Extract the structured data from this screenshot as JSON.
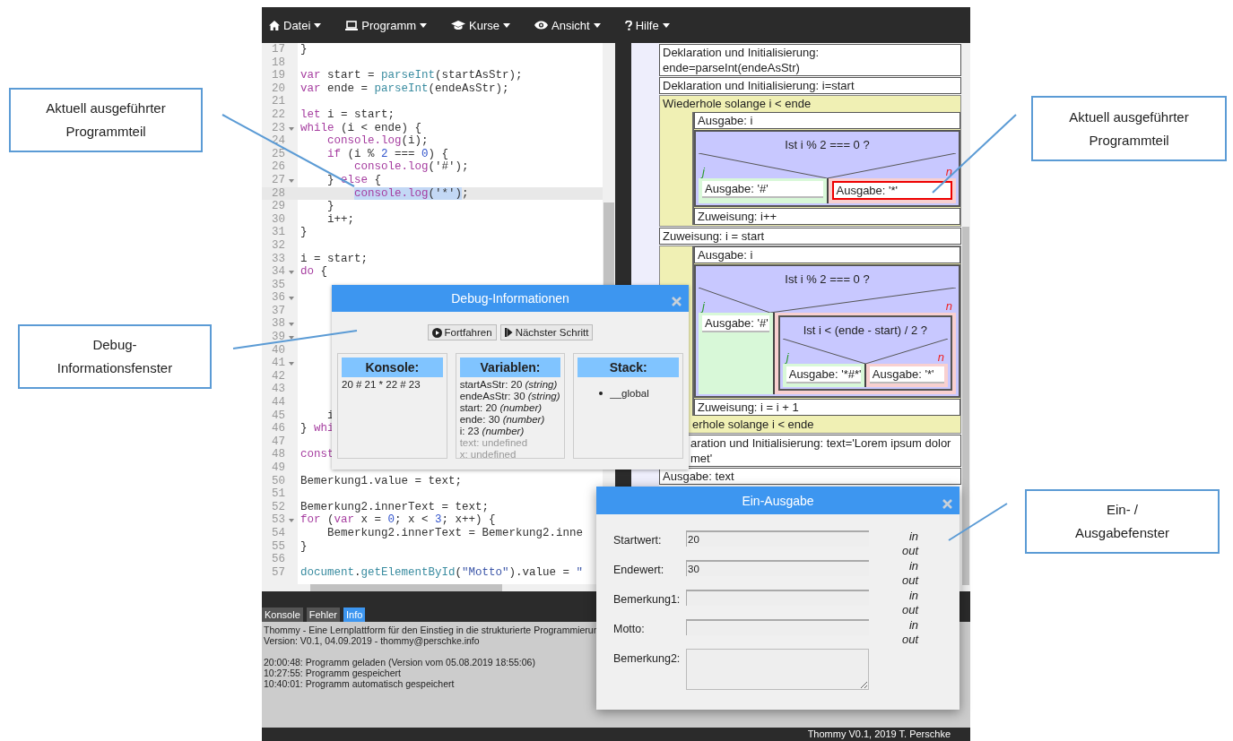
{
  "menu": [
    {
      "label": "Datei"
    },
    {
      "label": "Programm"
    },
    {
      "label": "Kurse"
    },
    {
      "label": "Ansicht"
    },
    {
      "label": "Hilfe"
    }
  ],
  "editor": {
    "lines": [
      {
        "n": "17",
        "fold": false,
        "current": false,
        "code": [
          "}"
        ]
      },
      {
        "n": "18",
        "fold": false,
        "current": false
      },
      {
        "n": "19",
        "fold": false,
        "current": false,
        "code": [
          {
            "kind": "kw",
            "t": "var"
          },
          " start = ",
          {
            "kind": "fn",
            "t": "parseInt"
          },
          "(startAsStr);"
        ]
      },
      {
        "n": "20",
        "fold": false,
        "current": false,
        "code": [
          {
            "kind": "kw",
            "t": "var"
          },
          " ende = ",
          {
            "kind": "fn",
            "t": "parseInt"
          },
          "(endeAsStr);"
        ]
      },
      {
        "n": "21",
        "fold": false,
        "current": false
      },
      {
        "n": "22",
        "fold": false,
        "current": false,
        "code": [
          {
            "kind": "kw",
            "t": "let"
          },
          " i = start;"
        ]
      },
      {
        "n": "23",
        "fold": true,
        "current": false,
        "code": [
          {
            "kind": "kw",
            "t": "while"
          },
          " (i < ende) {"
        ]
      },
      {
        "n": "24",
        "fold": false,
        "current": false,
        "code": [
          {
            "kind": "kw",
            "t": "    console.log"
          },
          "(i);"
        ]
      },
      {
        "n": "25",
        "fold": false,
        "current": false,
        "code": [
          {
            "kind": "kw",
            "t": "    if"
          },
          " (i % ",
          {
            "kind": "num",
            "t": "2"
          },
          " === ",
          {
            "kind": "num",
            "t": "0"
          },
          ") {"
        ]
      },
      {
        "n": "26",
        "fold": false,
        "current": false,
        "code": [
          {
            "kind": "kw",
            "t": "        console.log"
          },
          "('#');"
        ]
      },
      {
        "n": "27",
        "fold": true,
        "current": false,
        "code": [
          "    } ",
          {
            "kind": "kw",
            "t": "else"
          },
          " {"
        ]
      },
      {
        "n": "28",
        "fold": false,
        "current": true,
        "code": [
          {
            "kind": "kwsel",
            "t": "        console.log"
          },
          {
            "kind": "sel",
            "t": "('*')"
          },
          ";"
        ]
      },
      {
        "n": "29",
        "fold": false,
        "current": false,
        "code": [
          "    }"
        ]
      },
      {
        "n": "30",
        "fold": false,
        "current": false,
        "code": [
          "    i++;"
        ]
      },
      {
        "n": "31",
        "fold": false,
        "current": false,
        "code": [
          "}"
        ]
      },
      {
        "n": "32",
        "fold": false,
        "current": false
      },
      {
        "n": "33",
        "fold": false,
        "current": false,
        "code": [
          "i = start;"
        ]
      },
      {
        "n": "34",
        "fold": true,
        "current": false,
        "code": [
          {
            "kind": "kw",
            "t": "do"
          },
          " {"
        ]
      },
      {
        "n": "35",
        "fold": false,
        "current": false
      },
      {
        "n": "36",
        "fold": true,
        "current": false
      },
      {
        "n": "37",
        "fold": false,
        "current": false
      },
      {
        "n": "38",
        "fold": true,
        "current": false
      },
      {
        "n": "39",
        "fold": true,
        "current": false
      },
      {
        "n": "40",
        "fold": false,
        "current": false
      },
      {
        "n": "41",
        "fold": true,
        "current": false
      },
      {
        "n": "42",
        "fold": false,
        "current": false
      },
      {
        "n": "43",
        "fold": false,
        "current": false
      },
      {
        "n": "44",
        "fold": false,
        "current": false
      },
      {
        "n": "45",
        "fold": false,
        "current": false,
        "code": [
          "    i"
        ]
      },
      {
        "n": "46",
        "fold": false,
        "current": false,
        "code": [
          "} ",
          {
            "kind": "kw",
            "t": "whi"
          }
        ]
      },
      {
        "n": "47",
        "fold": false,
        "current": false
      },
      {
        "n": "48",
        "fold": false,
        "current": false,
        "code": [
          {
            "kind": "kw",
            "t": "const"
          }
        ]
      },
      {
        "n": "49",
        "fold": false,
        "current": false
      },
      {
        "n": "50",
        "fold": false,
        "current": false,
        "code": [
          "Bemerkung1.value = text;"
        ]
      },
      {
        "n": "51",
        "fold": false,
        "current": false
      },
      {
        "n": "52",
        "fold": false,
        "current": false,
        "code": [
          "Bemerkung2.innerText = text;"
        ]
      },
      {
        "n": "53",
        "fold": true,
        "current": false,
        "code": [
          {
            "kind": "kw",
            "t": "for"
          },
          " (",
          {
            "kind": "kw",
            "t": "var"
          },
          " x = ",
          {
            "kind": "num",
            "t": "0"
          },
          "; x < ",
          {
            "kind": "num",
            "t": "3"
          },
          "; x++) {"
        ]
      },
      {
        "n": "54",
        "fold": false,
        "current": false,
        "code": [
          "    Bemerkung2.innerText = Bemerkung2.inne"
        ]
      },
      {
        "n": "55",
        "fold": false,
        "current": false,
        "code": [
          "}"
        ]
      },
      {
        "n": "56",
        "fold": false,
        "current": false
      },
      {
        "n": "57",
        "fold": false,
        "current": false,
        "code": [
          {
            "kind": "fn",
            "t": "document"
          },
          ".",
          {
            "kind": "fn",
            "t": "getElementById"
          },
          "(",
          {
            "kind": "str",
            "t": "\"Motto\""
          },
          ").value = ",
          {
            "kind": "str",
            "t": "\""
          }
        ]
      }
    ]
  },
  "structogram": [
    {
      "kind": "statement",
      "text": "Deklaration und Initialisierung:\nende=parseInt(endeAsStr)",
      "active": false
    },
    {
      "kind": "statement",
      "text": "Deklaration und Initialisierung: i=start",
      "active": false
    },
    {
      "kind": "loop",
      "header": "Wiederhole solange i < ende",
      "body": [
        {
          "kind": "statement",
          "text": "Ausgabe: i",
          "active": false
        },
        {
          "kind": "if",
          "condition": "Ist i % 2 === 0 ?",
          "yes_label": "j",
          "no_label": "n",
          "yes": [
            {
              "kind": "statement",
              "text": "Ausgabe: '#'",
              "active": false
            }
          ],
          "no": [
            {
              "kind": "statement",
              "text": "Ausgabe: '*'",
              "active": true
            }
          ]
        },
        {
          "kind": "statement",
          "text": "Zuweisung: i++",
          "active": false
        }
      ]
    },
    {
      "kind": "statement",
      "text": "Zuweisung: i = start",
      "active": false
    },
    {
      "kind": "loop",
      "footer": "erhole solange i < ende",
      "body": [
        {
          "kind": "statement",
          "text": "Ausgabe: i",
          "active": false
        },
        {
          "kind": "if",
          "condition": "Ist i % 2 === 0 ?",
          "yes_label": "j",
          "no_label": "n",
          "yes": [
            {
              "kind": "statement",
              "text": "Ausgabe: '#'",
              "active": false
            }
          ],
          "no": [
            {
              "kind": "if",
              "condition": "Ist i < (ende - start) / 2 ?",
              "yes_label": "j",
              "no_label": "n",
              "yes": [
                {
                  "kind": "statement",
                  "text": "Ausgabe: '*#*'",
                  "active": false
                }
              ],
              "no": [
                {
                  "kind": "statement",
                  "text": "Ausgabe: '*'",
                  "active": false
                }
              ]
            }
          ]
        },
        {
          "kind": "statement",
          "text": "Zuweisung: i = i + 1",
          "active": false
        }
      ]
    },
    {
      "kind": "statement",
      "text": "aration und Initialisierung: text='Lorem ipsum dolor\nmet'",
      "active": false,
      "covered_left": true
    },
    {
      "kind": "statement",
      "text": "Ausgabe: text",
      "active": false
    }
  ],
  "bottom_panel": {
    "tabs": [
      {
        "label": "Konsole",
        "selected": false
      },
      {
        "label": "Fehler",
        "selected": false
      },
      {
        "label": "Info",
        "selected": true
      }
    ],
    "info": [
      [
        "Thommy - Eine Lernplattform für den Einstieg in die strukturierte Programmierun",
        "Version: V0.1, 04.09.2019 - thommy@perschke.info"
      ],
      [
        "20:00:48: Programm geladen (Version vom 05.08.2019 18:55:06)",
        "10:27:55: Programm gespeichert",
        "10:40:01: Programm automatisch gespeichert"
      ]
    ]
  },
  "status_bar": "Thommy V0.1, 2019 T. Perschke",
  "debug_window": {
    "title": "Debug-Informationen",
    "buttons": [
      {
        "label": "Fortfahren"
      },
      {
        "label": "Nächster Schritt"
      }
    ],
    "console": {
      "heading": "Konsole:",
      "output": "20 # 21 * 22 # 23"
    },
    "variables": {
      "heading": "Variablen:",
      "items": [
        {
          "text": "startAsStr: 20 *(string)*",
          "defined": true
        },
        {
          "text": "endeAsStr: 30 *(string)*",
          "defined": true
        },
        {
          "text": "start: 20 *(number)*",
          "defined": true
        },
        {
          "text": "ende: 30 *(number)*",
          "defined": true
        },
        {
          "text": "i: 23 *(number)*",
          "defined": true
        },
        {
          "text": "text: undefined",
          "defined": false
        },
        {
          "text": "x: undefined",
          "defined": false
        }
      ]
    },
    "stack": {
      "heading": "Stack:",
      "items": [
        "__global"
      ]
    }
  },
  "io_window": {
    "title": "Ein-Ausgabe",
    "fields": [
      {
        "label": "Startwert:",
        "kind": "input",
        "value": "20",
        "in_label": "in",
        "out_label": "out"
      },
      {
        "label": "Endewert:",
        "kind": "input",
        "value": "30",
        "in_label": "in",
        "out_label": "out"
      },
      {
        "label": "Bemerkung1:",
        "kind": "input",
        "in_label": "in",
        "out_label": "out"
      },
      {
        "label": "Motto:",
        "kind": "input",
        "in_label": "in",
        "out_label": "out"
      },
      {
        "label": "Bemerkung2:",
        "kind": "textarea"
      }
    ]
  },
  "annotations": [
    {
      "text": "Aktuell ausgeführter\nProgrammteil"
    },
    {
      "text": "Aktuell ausgeführter\nProgrammteil"
    },
    {
      "text": "Debug-\nInformationsfenster"
    },
    {
      "text": "Ein- /\nAusgabefenster"
    }
  ]
}
